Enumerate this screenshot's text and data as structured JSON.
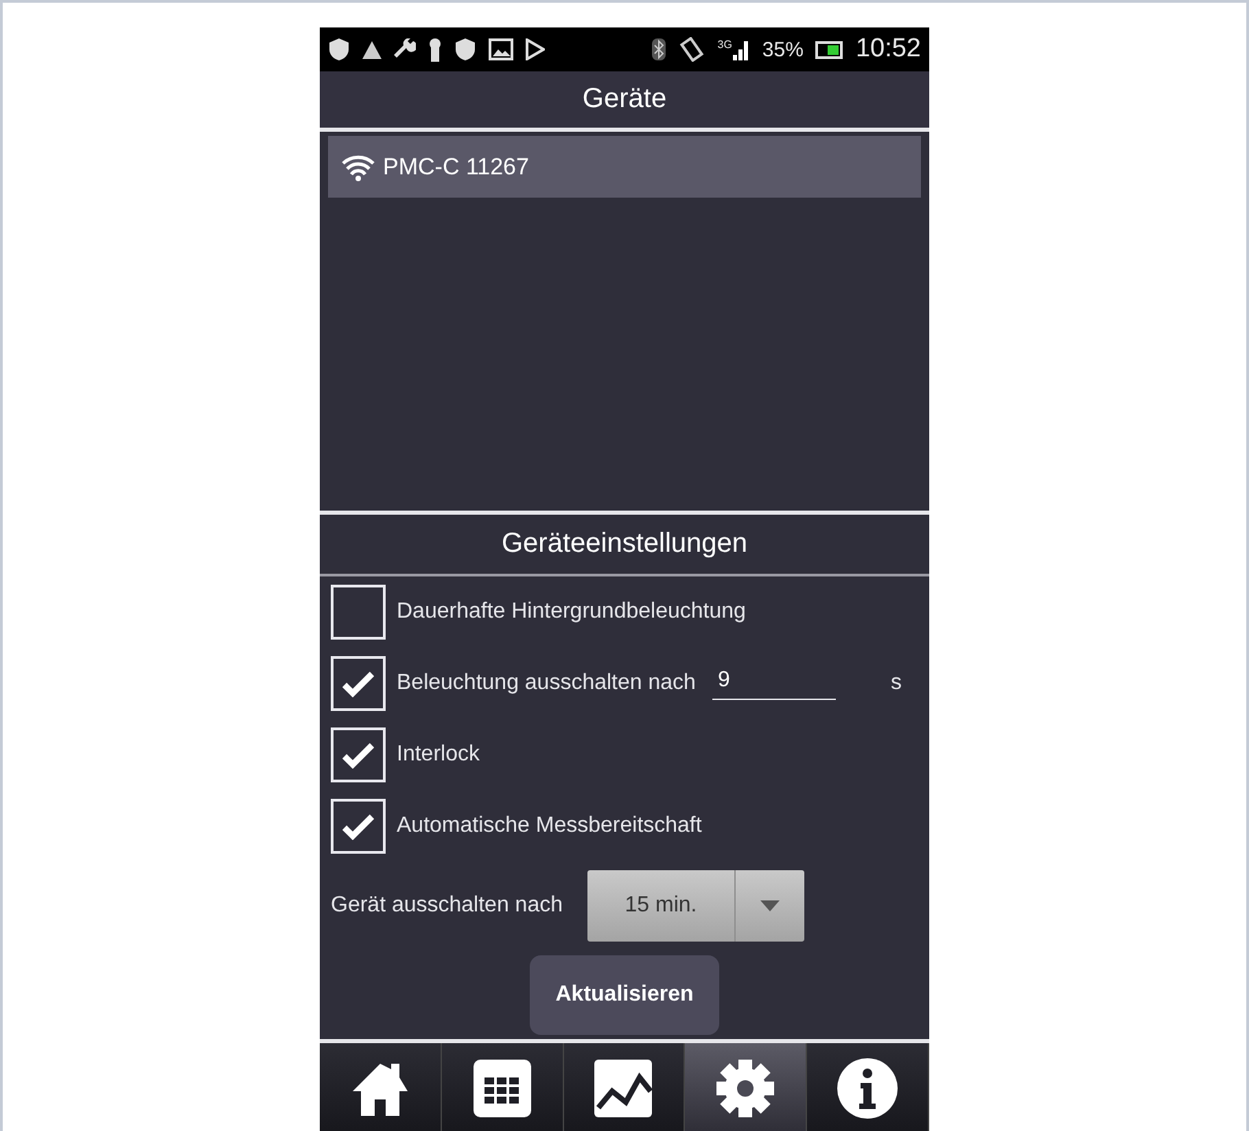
{
  "status_bar": {
    "network": "3G",
    "battery": "35%",
    "time": "10:52"
  },
  "devices": {
    "title": "Geräte",
    "items": [
      {
        "name": "PMC-C 11267",
        "selected": true
      }
    ]
  },
  "settings": {
    "title": "Geräteeinstellungen",
    "options": [
      {
        "kind": "checkbox",
        "label": "Dauerhafte Hintergrundbeleuchtung",
        "checked": false
      },
      {
        "kind": "input",
        "label": "Beleuchtung ausschalten nach",
        "checked": true,
        "value": "9",
        "unit": "s"
      },
      {
        "kind": "checkbox",
        "label": "Interlock",
        "checked": true
      },
      {
        "kind": "checkbox",
        "label": "Automatische Messbereitschaft",
        "checked": true
      }
    ],
    "shutdown": {
      "label": "Gerät ausschalten nach",
      "value": "15 min."
    },
    "button": "Aktualisieren"
  },
  "tabs": [
    {
      "kind": "home",
      "selected": false
    },
    {
      "kind": "table",
      "selected": false
    },
    {
      "kind": "chart",
      "selected": false
    },
    {
      "kind": "settings",
      "selected": true
    },
    {
      "kind": "info",
      "selected": false
    }
  ]
}
